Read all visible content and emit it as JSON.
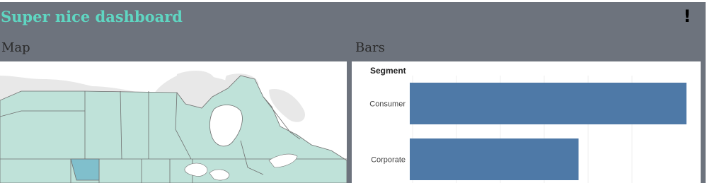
{
  "dashboard": {
    "title": "Super nice dashboard",
    "alert_glyph": "!",
    "alert_icon": "exclamation-icon",
    "background_color": "#6d737d",
    "title_color": "#5fd6c2"
  },
  "map_section": {
    "title": "Map",
    "fill_color": "#bfe2d9",
    "highlight_color": "#80bfcc"
  },
  "bars_section": {
    "title": "Bars",
    "bar_color": "#4e79a7"
  },
  "chart_data": {
    "type": "bar",
    "orientation": "horizontal",
    "row_header": "Segment",
    "categories": [
      "Consumer",
      "Corporate"
    ],
    "values": [
      100,
      61
    ],
    "xlim": [
      0,
      100
    ],
    "grid": true
  }
}
